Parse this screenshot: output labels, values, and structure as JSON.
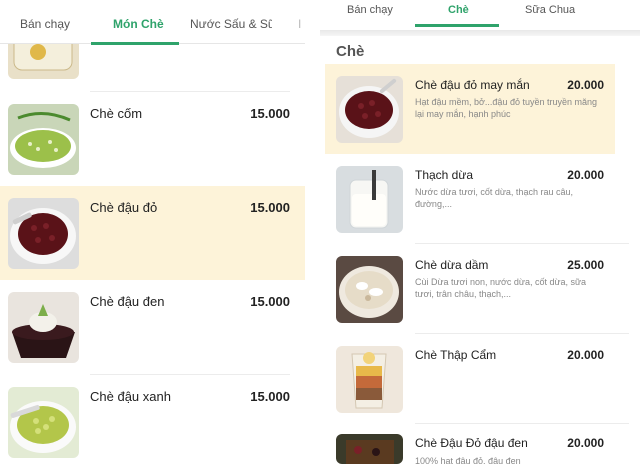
{
  "left": {
    "tabs": [
      {
        "label": "Bán chạy",
        "active": false
      },
      {
        "label": "Món Chè",
        "active": true
      },
      {
        "label": "Nước Sấu & Sữa...",
        "active": false
      }
    ],
    "items": [
      {
        "name": "Chè cốm",
        "price": "15.000",
        "highlighted": false
      },
      {
        "name": "Chè đậu đỏ",
        "price": "15.000",
        "highlighted": true
      },
      {
        "name": "Chè đậu đen",
        "price": "15.000",
        "highlighted": false
      },
      {
        "name": "Chè đậu xanh",
        "price": "15.000",
        "highlighted": false
      }
    ]
  },
  "right": {
    "tabs": [
      {
        "label": "Bán chạy",
        "active": false
      },
      {
        "label": "Chè",
        "active": true
      },
      {
        "label": "Sữa Chua",
        "active": false
      }
    ],
    "section_title": "Chè",
    "items": [
      {
        "name": "Chè đậu đỏ may mắn",
        "price": "20.000",
        "desc": "Hạt đậu mềm, bở...đậu đỏ tuyền truyền măng lại may mắn, hạnh phúc",
        "highlighted": true
      },
      {
        "name": "Thạch dừa",
        "price": "20.000",
        "desc": "Nước dừa tươi, cốt dừa, thạch rau câu, đường,...",
        "highlighted": false
      },
      {
        "name": "Chè dừa dầm",
        "price": "25.000",
        "desc": "Cùi Dừa tươi non, nước dừa, cốt dừa, sữa tươi, trân châu, thạch,...",
        "highlighted": false
      },
      {
        "name": "Chè Thập Cẩm",
        "price": "20.000",
        "desc": "",
        "highlighted": false
      },
      {
        "name": "Chè Đậu Đỏ đậu đen",
        "price": "20.000",
        "desc": "100% hạt đậu đỏ, đậu đen",
        "highlighted": false
      }
    ]
  },
  "colors": {
    "accent": "#2fa36b",
    "highlight": "#fdf3d9"
  }
}
